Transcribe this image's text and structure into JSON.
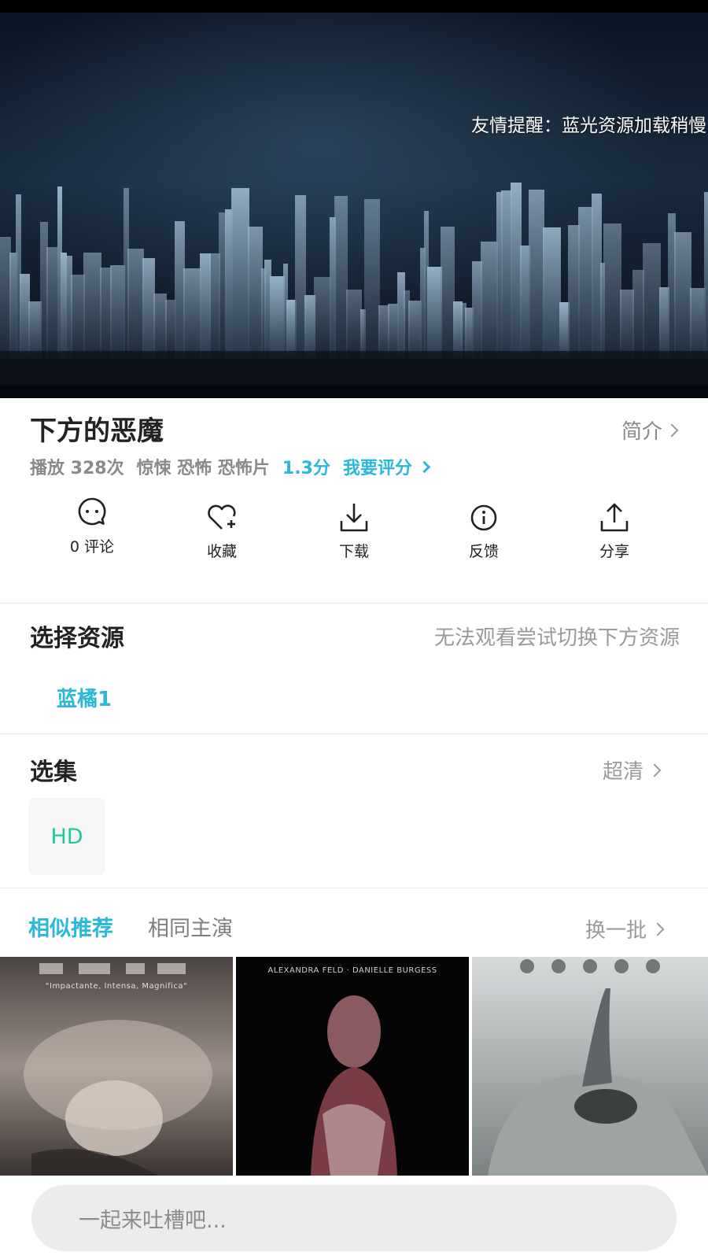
{
  "player": {
    "notice": "友情提醒：蓝光资源加载稍慢"
  },
  "movie": {
    "title": "下方的恶魔",
    "intro_label": "简介",
    "plays": "播放 328次",
    "genres": "惊悚 恐怖 恐怖片",
    "score": "1.3分",
    "rate_label": "我要评分"
  },
  "actions": [
    {
      "label": "0 评论",
      "icon": "comment-icon"
    },
    {
      "label": "收藏",
      "icon": "heart-plus-icon"
    },
    {
      "label": "下载",
      "icon": "download-icon"
    },
    {
      "label": "反馈",
      "icon": "info-icon"
    },
    {
      "label": "分享",
      "icon": "share-icon"
    }
  ],
  "sources": {
    "title": "选择资源",
    "hint": "无法观看尝试切换下方资源",
    "items": [
      "蓝橘1"
    ]
  },
  "episodes": {
    "title": "选集",
    "quality": "超清",
    "items": [
      "HD"
    ]
  },
  "recommend": {
    "tabs": [
      "相似推荐",
      "相同主演"
    ],
    "refresh": "换一批",
    "posters": [
      {
        "caption": "\"Impactante, Intensa, Magnifica\""
      },
      {
        "caption": "ALEXANDRA FELD · DANIELLE BURGESS"
      },
      {
        "caption": ""
      }
    ]
  },
  "comment": {
    "placeholder": "一起来吐槽吧..."
  },
  "colors": {
    "accent": "#2bb8d9",
    "episode_text": "#1fc79b",
    "muted": "#9a9a9a"
  }
}
